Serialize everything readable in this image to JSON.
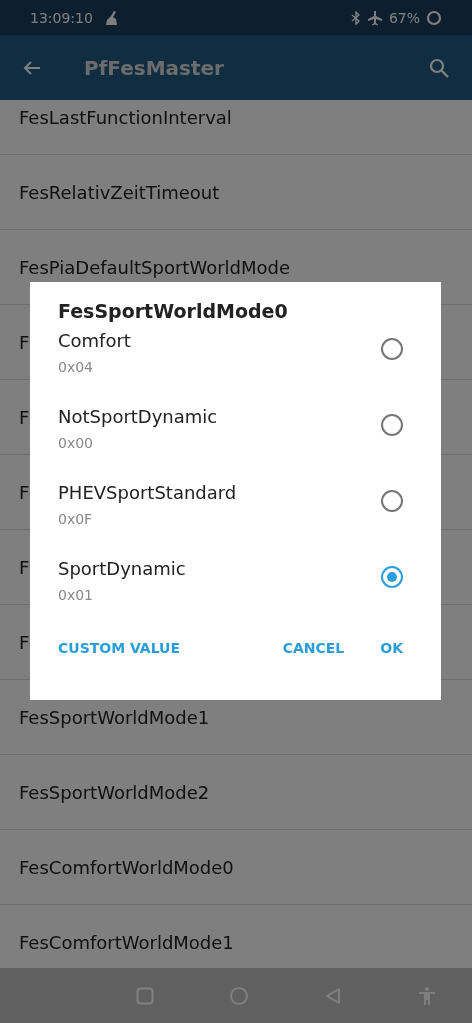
{
  "status_bar": {
    "time": "13:09:10",
    "battery": "67%"
  },
  "app_bar": {
    "title": "PfFesMaster"
  },
  "list": [
    {
      "label": "FesLastFunctionInterval"
    },
    {
      "label": "FesRelativZeitTimeout"
    },
    {
      "label": "FesPiaDefaultSportWorldMode"
    },
    {
      "label": "F"
    },
    {
      "label": "F"
    },
    {
      "label": "F"
    },
    {
      "label": "F"
    },
    {
      "label": "F"
    },
    {
      "label": "FesSportWorldMode1"
    },
    {
      "label": "FesSportWorldMode2"
    },
    {
      "label": "FesComfortWorldMode0"
    },
    {
      "label": "FesComfortWorldMode1"
    }
  ],
  "dialog": {
    "title": "FesSportWorldMode0",
    "options": [
      {
        "label": "Comfort",
        "value": "0x04",
        "selected": false
      },
      {
        "label": "NotSportDynamic",
        "value": "0x00",
        "selected": false
      },
      {
        "label": "PHEVSportStandard",
        "value": "0x0F",
        "selected": false
      },
      {
        "label": "SportDynamic",
        "value": "0x01",
        "selected": true
      }
    ],
    "buttons": {
      "left": "CUSTOM VALUE",
      "cancel": "CANCEL",
      "ok": "OK"
    }
  }
}
